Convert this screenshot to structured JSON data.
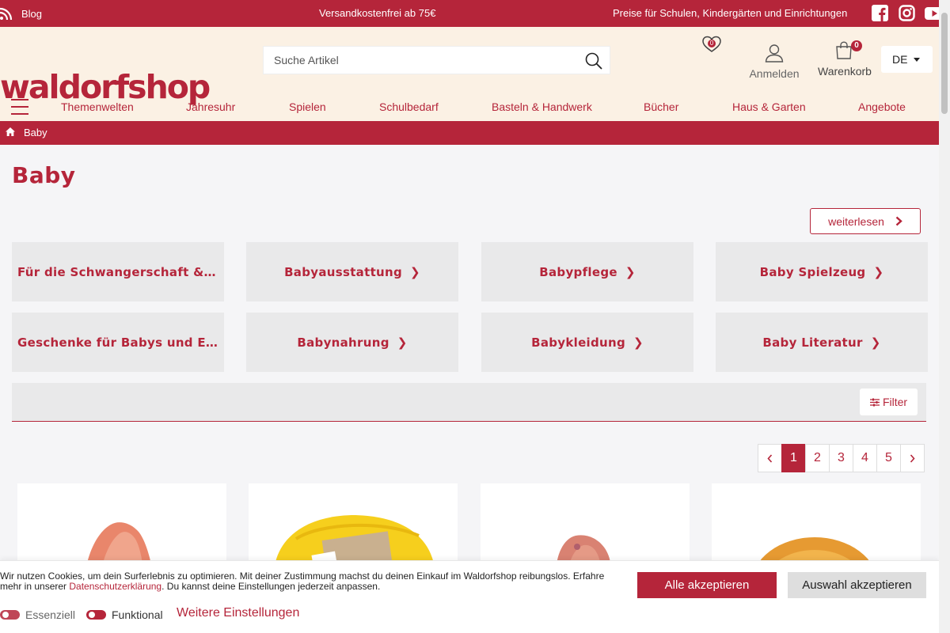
{
  "topbar": {
    "blog": "Blog",
    "shipping": "Versandkostenfrei ab 75€",
    "prices": "Preise für Schulen, Kindergärten und Einrichtungen",
    "social": [
      "facebook-icon",
      "instagram-icon",
      "youtube-icon"
    ]
  },
  "header": {
    "logo": "waldorfshop",
    "search_placeholder": "Suche Artikel",
    "wishlist_count": "0",
    "login": "Anmelden",
    "cart": "Warenkorb",
    "cart_count": "0",
    "language": "DE"
  },
  "nav": [
    "Themenwelten",
    "Jahresuhr",
    "Spielen",
    "Schulbedarf",
    "Basteln & Handwerk",
    "Bücher",
    "Haus & Garten",
    "Angebote"
  ],
  "breadcrumb": {
    "current": "Baby"
  },
  "page": {
    "title": "Baby",
    "read_more": "weiterlesen",
    "subcategories": [
      "Für die Schwangerschaft & Stillzeit",
      "Babyausstattung",
      "Babypflege",
      "Baby Spielzeug",
      "Geschenke für Babys und Eltern",
      "Babynahrung",
      "Babykleidung",
      "Baby Literatur"
    ],
    "filter": "Filter",
    "pagination": {
      "pages": [
        "1",
        "2",
        "3",
        "4",
        "5"
      ],
      "current": "1"
    }
  },
  "cookie": {
    "text_before": "Wir nutzen Cookies, um dein Surferlebnis zu optimieren. Mit deiner Zustimmung machst du deinen Einkauf im Waldorfshop reibungslos. Erfahre mehr in unserer ",
    "link": "Datenschutzerklärung",
    "text_after": ". Du kannst deine Einstellungen jederzeit anpassen.",
    "accept_all": "Alle akzeptieren",
    "accept_selection": "Auswahl akzeptieren",
    "toggle_essential": "Essenziell",
    "toggle_functional": "Funktional",
    "more_settings": "Weitere Einstellungen"
  },
  "colors": {
    "brand": "#b5253a",
    "header_bg": "#fbf1e4",
    "tile_bg": "#e9e9ea"
  }
}
